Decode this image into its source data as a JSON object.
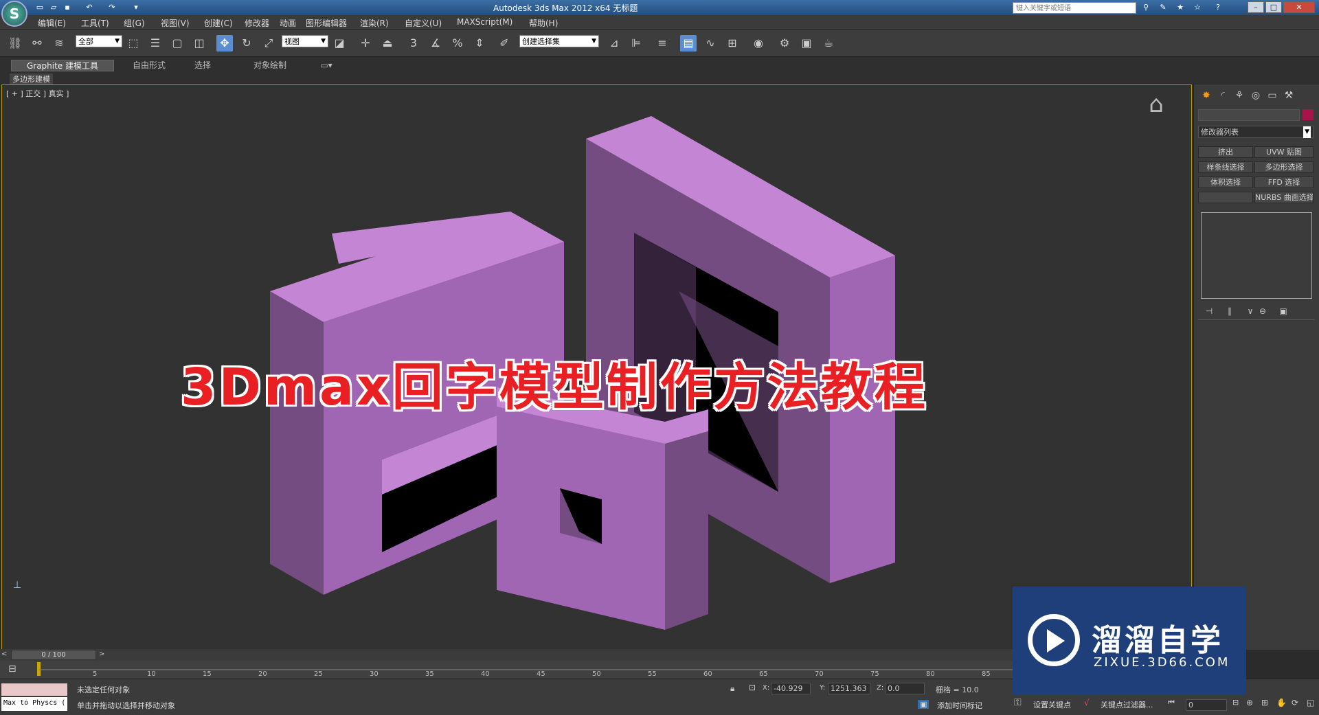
{
  "window": {
    "title": "Autodesk 3ds Max  2012 x64      无标题",
    "search_placeholder": "键入关键字或短语"
  },
  "menu": [
    "编辑(E)",
    "工具(T)",
    "组(G)",
    "视图(V)",
    "创建(C)",
    "修改器",
    "动画",
    "图形编辑器",
    "渲染(R)",
    "自定义(U)",
    "MAXScript(M)",
    "帮助(H)"
  ],
  "toolbar": {
    "selection_filter": "全部",
    "ref_coord": "视图",
    "named_selection": "创建选择集"
  },
  "ribbon": {
    "tabs": [
      "Graphite 建模工具",
      "自由形式",
      "选择",
      "对象绘制"
    ],
    "sub": "多边形建模"
  },
  "viewport": {
    "label": "[ + ] 正交 ] 真实 ]",
    "overlay_title": "3Dmax回字模型制作方法教程"
  },
  "command_panel": {
    "modifier_list": "修改器列表",
    "buttons": [
      "挤出",
      "UVW 贴图",
      "样条线选择",
      "多边形选择",
      "体积选择",
      "FFD 选择",
      "",
      "NURBS 曲面选择"
    ]
  },
  "timeline": {
    "frame": "0 / 100",
    "ticks": [
      "5",
      "10",
      "15",
      "20",
      "25",
      "30",
      "35",
      "40",
      "45",
      "50",
      "55",
      "60",
      "65",
      "70",
      "75",
      "80",
      "85"
    ]
  },
  "status": {
    "maxscript": "Max to Physcs (",
    "line1": "未选定任何对象",
    "line2": "单击并拖动以选择并移动对象",
    "x_label": "X:",
    "x": "-40.929",
    "y_label": "Y:",
    "y": "1251.363",
    "z_label": "Z:",
    "z": "0.0",
    "grid": "栅格 = 10.0",
    "add_time_tag": "添加时间标记",
    "set_key": "设置关键点",
    "key_filters": "关键点过滤器...",
    "frame_field": "0"
  },
  "watermark": {
    "name": "溜溜自学",
    "url": "ZIXUE.3D66.COM"
  },
  "colors": {
    "object": "#c486d4",
    "object_side": "#a065b3",
    "object_dark": "#744c82",
    "accent": "#e82024"
  }
}
